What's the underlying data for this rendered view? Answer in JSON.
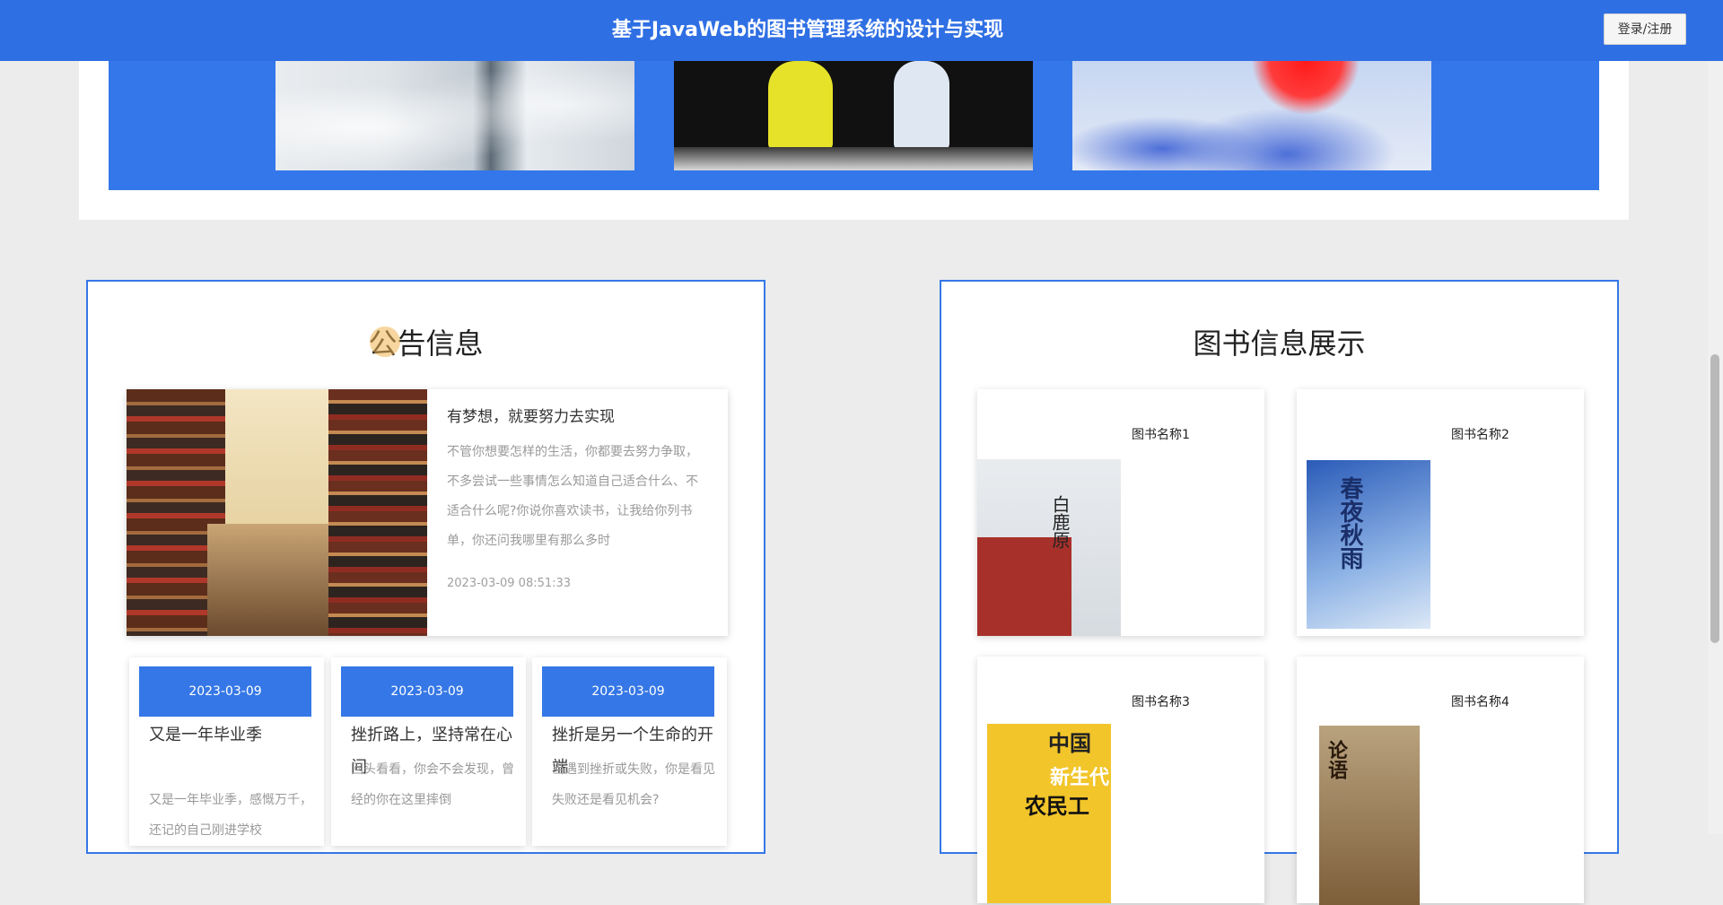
{
  "header": {
    "title": "基于JavaWeb的图书管理系统的设计与实现",
    "login_label": "登录/注册"
  },
  "banner": {
    "images": [
      "banner-image-clouds",
      "banner-image-anime-figures",
      "banner-image-blue-scene"
    ]
  },
  "notices": {
    "title": "公告信息",
    "featured": {
      "heading": "有梦想，就要努力去实现",
      "body": "不管你想要怎样的生活，你都要去努力争取，不多尝试一些事情怎么知道自己适合什么、不适合什么呢?你说你喜欢读书，让我给你列书单，你还问我哪里有那么多时",
      "date": "2023-03-09 08:51:33"
    },
    "items": [
      {
        "date": "2023-03-09",
        "title": "又是一年毕业季",
        "text": "又是一年毕业季，感慨万千，还记的自己刚进学校"
      },
      {
        "date": "2023-03-09",
        "title": "挫折路上，坚持常在心间",
        "text": "回头看看，你会不会发现，曾经的你在这里摔倒"
      },
      {
        "date": "2023-03-09",
        "title": "挫折是另一个生命的开端",
        "text": "当遇到挫折或失败，你是看见失败还是看见机会?"
      }
    ]
  },
  "books": {
    "title": "图书信息展示",
    "items": [
      {
        "name": "图书名称1",
        "cover_text": "白鹿原"
      },
      {
        "name": "图书名称2",
        "cover_text": "春夜秋雨"
      },
      {
        "name": "图书名称3",
        "cover_text_1": "中国",
        "cover_text_2": "新生代",
        "cover_text_3": "农民工"
      },
      {
        "name": "图书名称4",
        "cover_text": "论语"
      }
    ]
  },
  "colors": {
    "primary": "#2f6fe4",
    "accent": "#3577e6",
    "background": "#ececec"
  }
}
